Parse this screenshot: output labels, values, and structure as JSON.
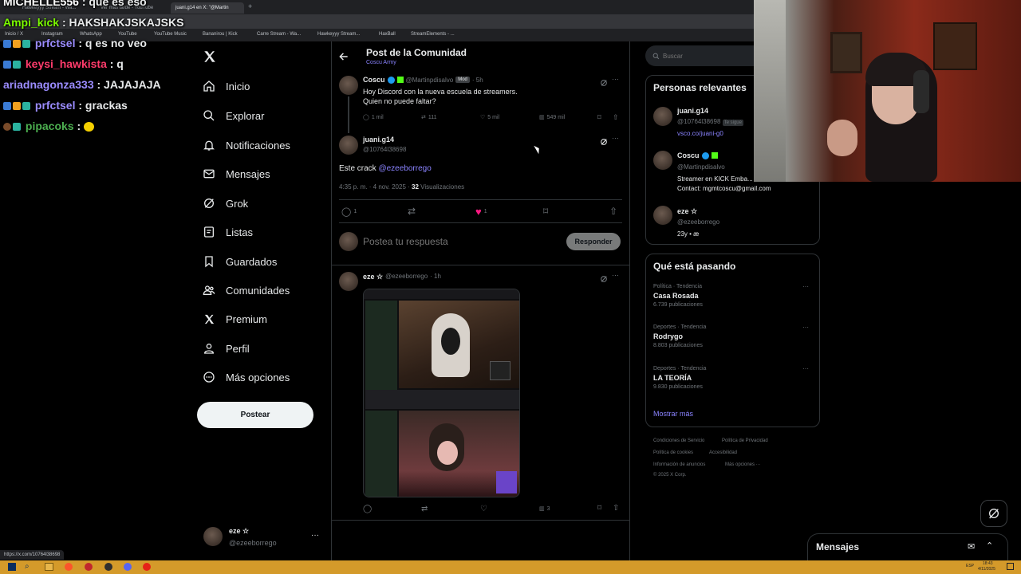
{
  "browser": {
    "tabs": [
      {
        "label": "Hawkeyyy Stream - Wa..."
      },
      {
        "label": "Ver más tarde - YouTube"
      },
      {
        "label": "juani.g14 en X: \"@Martin"
      }
    ],
    "bookmarks": [
      "Inicio / X",
      "Instagram",
      "WhatsApp",
      "YouTube",
      "YouTube Music",
      "Bananirou | Kick",
      "Carre Stream - Wa...",
      "Hawkeyyy Stream...",
      "HaxBall",
      "StreamElements - ..."
    ],
    "status_url": "https://x.com/10764l38698"
  },
  "chat": [
    {
      "user": "MICHELLE556",
      "msg": ": que es eso",
      "color": "#ffffff"
    },
    {
      "user": "Ampi_kick",
      "msg": ": HAKSHAKJSKAJSKS",
      "color": "#7cfc00"
    },
    {
      "user": "prfctsel",
      "msg": ": q es no veo",
      "color": "#9b8cff"
    },
    {
      "user": "keysi_hawkista",
      "msg": ": q",
      "color": "#ff3b6b"
    },
    {
      "user": "ariadnagonza333",
      "msg": ": JAJAJAJA",
      "color": "#9b8cff"
    },
    {
      "user": "prfctsel",
      "msg": ": grackas",
      "color": "#9b8cff"
    },
    {
      "user": "pipacoks",
      "msg": ":",
      "color": "#4caf50"
    }
  ],
  "nav": {
    "items": [
      "Inicio",
      "Explorar",
      "Notificaciones",
      "Mensajes",
      "Grok",
      "Listas",
      "Guardados",
      "Comunidades",
      "Premium",
      "Perfil",
      "Más opciones"
    ],
    "post_label": "Postear",
    "account_name": "eze ☆",
    "account_handle": "@ezeeborrego"
  },
  "header": {
    "title": "Post de la Comunidad",
    "subtitle": "Coscu Army"
  },
  "parent_post": {
    "name": "Coscu",
    "handle": "@Martinpdisalvo",
    "badge": "Mod",
    "time": "· 5h",
    "text_1": "Hoy Discord con la nueva escuela de streamers.",
    "text_2": "Quien no puede faltar?",
    "replies": "1 mil",
    "reposts": "111",
    "likes": "5 mil",
    "views": "549 mil"
  },
  "main_post": {
    "name": "juani.g14",
    "handle": "@10764l38698",
    "text": "Este crack",
    "mention": "@ezeeborrego",
    "meta": "4:35 p. m. · 4 nov. 2025 · ",
    "views_count": "32",
    "views_label": " Visualizaciones",
    "replies": "1",
    "likes": "1"
  },
  "reply_box": {
    "placeholder": "Postea tu respuesta",
    "button": "Responder"
  },
  "reply_post": {
    "name": "eze ☆",
    "handle": "@ezeeborrego",
    "time": "· 1h",
    "views": "3"
  },
  "right": {
    "search_placeholder": "Buscar",
    "relevant_title": "Personas relevantes",
    "people": [
      {
        "name": "juani.g14",
        "handle": "@10764l38698",
        "follows": "Te sigue",
        "bio": "vsco.co/juani-g0"
      },
      {
        "name": "Coscu",
        "handle": "@Martinpdisalvo",
        "bio": "Streamer en KICK Emba...",
        "bio2": "Contact: mgmtcoscu@gmail.com"
      },
      {
        "name": "eze ☆",
        "handle": "@ezeeborrego",
        "bio": "23y • æ"
      }
    ],
    "trends_title": "Qué está pasando",
    "trends": [
      {
        "cat": "Política · Tendencia",
        "name": "Casa Rosada",
        "count": "6.739 publicaciones"
      },
      {
        "cat": "Deportes · Tendencia",
        "name": "Rodrygo",
        "count": "8.803 publicaciones"
      },
      {
        "cat": "Deportes · Tendencia",
        "name": "LA TEORÍA",
        "count": "9.830 publicaciones"
      }
    ],
    "show_more": "Mostrar más",
    "footer": [
      "Condiciones de Servicio",
      "Política de Privacidad",
      "Política de cookies",
      "Accesibilidad",
      "Información de anuncios",
      "Más opciones ···",
      "© 2025 X Corp."
    ],
    "messages_label": "Mensajes"
  },
  "taskbar": {
    "time": "18:43",
    "date": "4/11/2025",
    "lang": "ESP"
  },
  "colors": {
    "accent": "#1d9bf0",
    "link": "#8a83ff",
    "like": "#f91880",
    "taskbar": "#d49a2a"
  }
}
